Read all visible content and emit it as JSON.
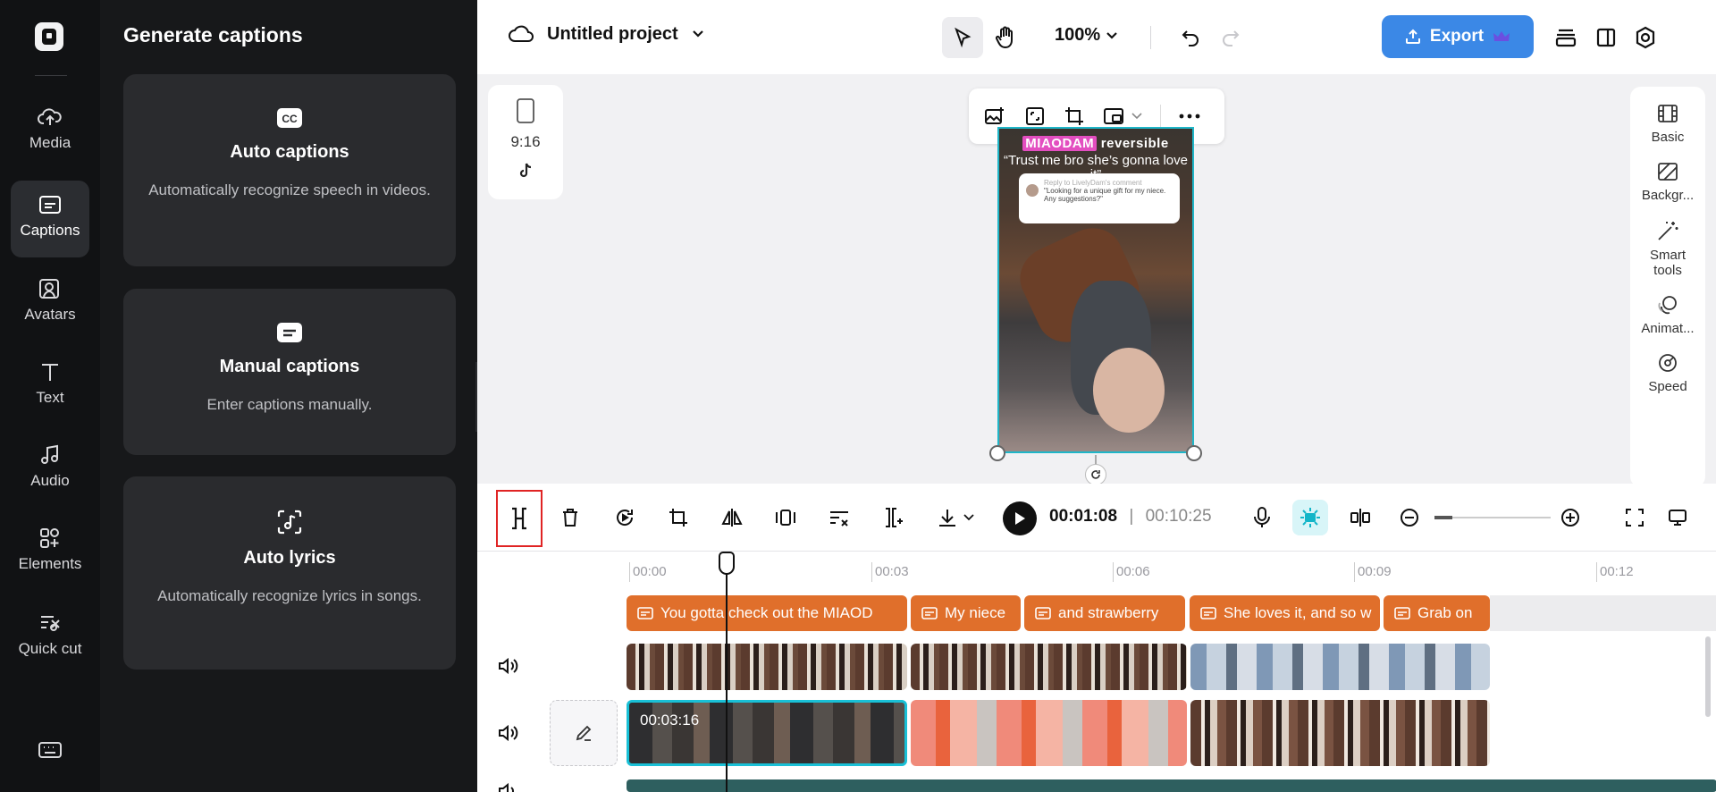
{
  "rail": {
    "items": [
      {
        "label": "Media",
        "icon": "cloud-upload-icon"
      },
      {
        "label": "Captions",
        "icon": "captions-icon"
      },
      {
        "label": "Avatars",
        "icon": "avatar-icon"
      },
      {
        "label": "Text",
        "icon": "text-icon"
      },
      {
        "label": "Audio",
        "icon": "music-icon"
      },
      {
        "label": "Elements",
        "icon": "elements-icon"
      },
      {
        "label": "Quick cut",
        "icon": "quick-cut-icon"
      }
    ],
    "active": "Captions"
  },
  "panel": {
    "title": "Generate captions",
    "cards": [
      {
        "title": "Auto captions",
        "desc": "Automatically recognize speech in videos.",
        "icon": "cc-icon"
      },
      {
        "title": "Manual captions",
        "desc": "Enter captions manually.",
        "icon": "keyboard-caption-icon"
      },
      {
        "title": "Auto lyrics",
        "desc": "Automatically recognize lyrics in songs.",
        "icon": "music-note-icon"
      }
    ]
  },
  "topbar": {
    "project_name": "Untitled project",
    "zoom": "100%",
    "export_label": "Export"
  },
  "canvas": {
    "ratio_label": "9:16",
    "video": {
      "title_highlight": "MIAODAM",
      "title_rest": "reversible",
      "subtitle": "“Trust me bro she’s gonna love it”",
      "bubble_header": "Reply to LivelyDam's comment",
      "bubble_text": "\"Looking for a unique gift for my niece. Any suggestions?\""
    },
    "right_tools": [
      {
        "label": "Basic",
        "icon": "film-icon"
      },
      {
        "label": "Backgr...",
        "icon": "background-icon"
      },
      {
        "label": "Smart tools",
        "icon": "magic-wand-icon"
      },
      {
        "label": "Animat...",
        "icon": "animation-icon"
      },
      {
        "label": "Speed",
        "icon": "speed-icon"
      }
    ]
  },
  "player": {
    "current_time": "00:01:08",
    "total_time": "00:10:25"
  },
  "timeline": {
    "ticks": [
      "00:00",
      "00:03",
      "00:06",
      "00:09",
      "00:12"
    ],
    "caption_clips": [
      "You gotta check out the MIAOD",
      "My niece",
      "and strawberry",
      "She loves it, and so w",
      "Grab on"
    ],
    "main_clip_time": "00:03:16"
  }
}
